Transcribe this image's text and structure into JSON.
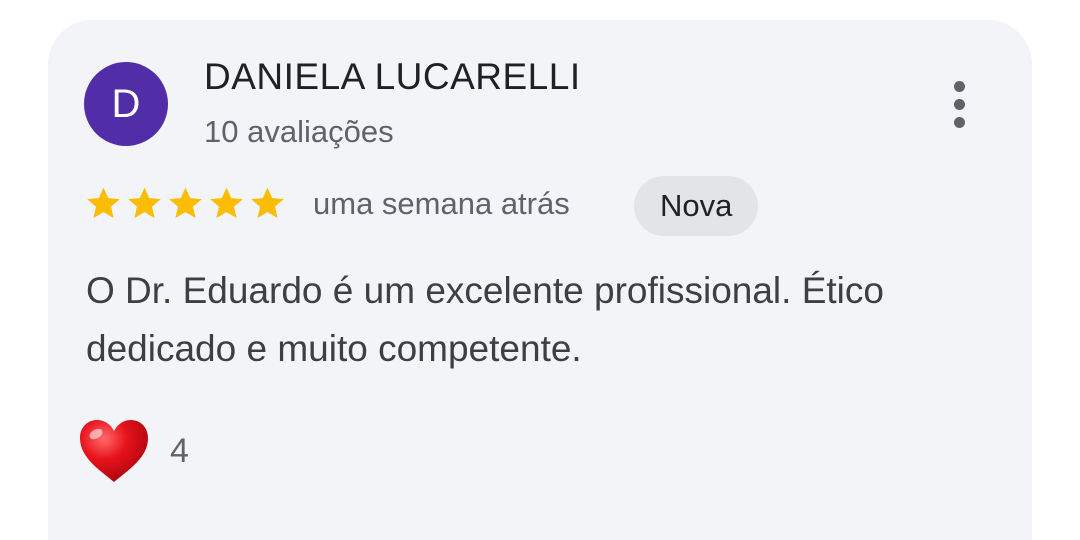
{
  "review": {
    "author_initial": "D",
    "author_name": "DANIELA LUCARELLI",
    "review_count": "10 avaliações",
    "rating": 5,
    "max_rating": 5,
    "date": "uma semana atrás",
    "badge": "Nova",
    "text": "O Dr. Eduardo é um excelente profissional. Ético dedicado e muito competente.",
    "reaction_count": "4"
  },
  "icons": {
    "more": "more-vert-icon",
    "star": "star-icon",
    "reaction": "heart-icon"
  },
  "colors": {
    "card_background": "#f3f4f7",
    "avatar": "#512da8",
    "star": "#fbbc04",
    "badge_background": "#e3e4e8",
    "heart": "#e0151f"
  }
}
